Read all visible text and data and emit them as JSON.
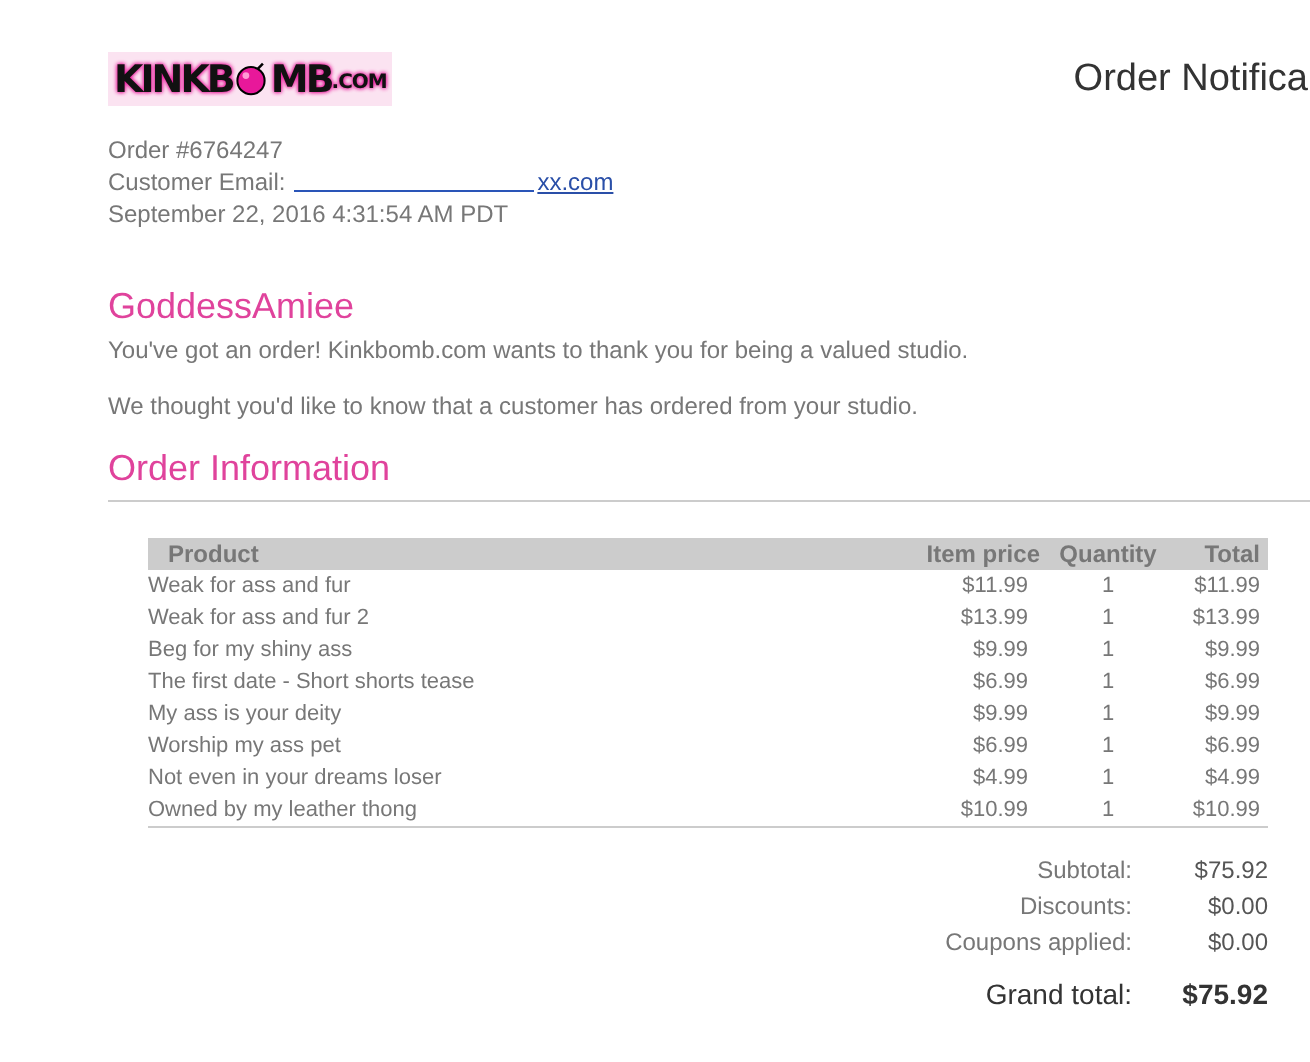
{
  "logo": {
    "before_bomb": "KINKB",
    "after_bomb": "MB",
    "suffix": ".COM"
  },
  "title": "Order Notifica",
  "order_number": "Order #6764247",
  "customer_email": {
    "label": "Customer Email:",
    "link": "xx.com"
  },
  "timestamp": "September 22, 2016 4:31:54 AM PDT",
  "studio_name": "GoddessAmiee",
  "messages": [
    "You've got an order! Kinkbomb.com wants to thank you for being a valued studio.",
    "We thought you'd like to know that a customer has ordered from your studio."
  ],
  "section_title": "Order Information",
  "table": {
    "columns": [
      "Product",
      "Item price",
      "Quantity",
      "Total"
    ],
    "rows": [
      [
        "Weak for ass and fur",
        "$11.99",
        "1",
        "$11.99"
      ],
      [
        "Weak for ass and fur 2",
        "$13.99",
        "1",
        "$13.99"
      ],
      [
        "Beg for my shiny ass",
        "$9.99",
        "1",
        "$9.99"
      ],
      [
        "The first date - Short shorts tease",
        "$6.99",
        "1",
        "$6.99"
      ],
      [
        "My ass is your deity",
        "$9.99",
        "1",
        "$9.99"
      ],
      [
        "Worship my ass pet",
        "$6.99",
        "1",
        "$6.99"
      ],
      [
        "Not even in your dreams loser",
        "$4.99",
        "1",
        "$4.99"
      ],
      [
        "Owned by my leather thong",
        "$10.99",
        "1",
        "$10.99"
      ]
    ]
  },
  "summary": [
    {
      "label": "Subtotal:",
      "value": "$75.92"
    },
    {
      "label": "Discounts:",
      "value": "$0.00"
    },
    {
      "label": "Coupons applied:",
      "value": "$0.00"
    }
  ],
  "grand_total": {
    "label": "Grand total:",
    "value": "$75.92"
  }
}
